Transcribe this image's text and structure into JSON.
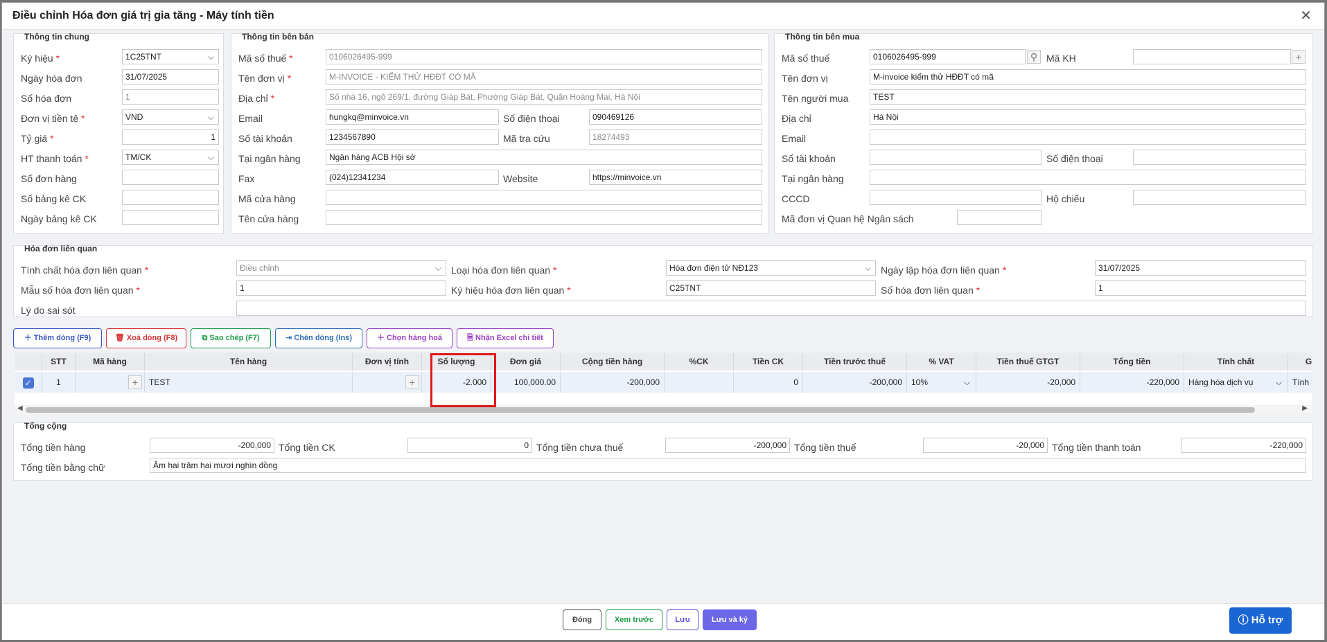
{
  "title": "Điều chỉnh Hóa đơn giá trị gia tăng - Máy tính tiền",
  "general": {
    "section": "Thông tin chung",
    "ky_hieu_label": "Ký hiệu",
    "ky_hieu": "1C25TNT",
    "ngay_hd_label": "Ngày hóa đơn",
    "ngay_hd": "31/07/2025",
    "so_hd_label": "Số hóa đơn",
    "so_hd": "1",
    "don_vi_tt_label": "Đơn vị tiền tệ",
    "don_vi_tt": "VND",
    "ty_gia_label": "Tỷ giá",
    "ty_gia": "1",
    "ht_tt_label": "HT thanh toán",
    "ht_tt": "TM/CK",
    "so_don_hang_label": "Số đơn hàng",
    "so_bang_ke_label": "Số bảng kê CK",
    "ngay_bang_ke_label": "Ngày bảng kê CK"
  },
  "seller": {
    "section": "Thông tin bên bán",
    "mst_label": "Mã số thuế",
    "mst": "0106026495-999",
    "ten_dv_label": "Tên đơn vị",
    "ten_dv": "M-INVOICE - KIỂM THỬ HĐĐT CÓ MÃ",
    "dia_chi_label": "Địa chỉ",
    "dia_chi": "Số nhà 16, ngõ 269/1, đường Giáp Bát, Phường Giáp Bát, Quận Hoàng Mai, Hà Nội",
    "email_label": "Email",
    "email": "hungkq@minvoice.vn",
    "sdt_label": "Số điện thoại",
    "sdt": "090469126",
    "stk_label": "Số tài khoản",
    "stk": "1234567890",
    "ma_tra_cuu_label": "Mã tra cứu",
    "ma_tra_cuu": "18274493",
    "ngan_hang_label": "Tại ngân hàng",
    "ngan_hang": "Ngân hàng ACB Hội sở",
    "fax_label": "Fax",
    "fax": "(024)12341234",
    "website_label": "Website",
    "website": "https://minvoice.vn",
    "ma_cua_hang_label": "Mã cửa hàng",
    "ten_cua_hang_label": "Tên cửa hàng"
  },
  "buyer": {
    "section": "Thông tin bên mua",
    "mst_label": "Mã số thuế",
    "mst": "0106026495-999",
    "ma_kh_label": "Mã KH",
    "ten_dv_label": "Tên đơn vị",
    "ten_dv": "M-invoice kiểm thử HĐĐT có mã",
    "ten_nguoi_mua_label": "Tên người mua",
    "ten_nguoi_mua": "TEST",
    "dia_chi_label": "Địa chỉ",
    "dia_chi": "Hà Nội",
    "email_label": "Email",
    "stk_label": "Số tài khoản",
    "sdt_label": "Số điện thoại",
    "ngan_hang_label": "Tại ngân hàng",
    "cccd_label": "CCCD",
    "ho_chieu_label": "Hộ chiếu",
    "ma_dv_qhns_label": "Mã đơn vị Quan hệ Ngân sách"
  },
  "related": {
    "section": "Hóa đơn liên quan",
    "tinh_chat_label": "Tính chất hóa đơn liên quan",
    "tinh_chat": "Điều chỉnh",
    "loai_hd_label": "Loại hóa đơn liên quan",
    "loai_hd": "Hóa đơn điện tử NĐ123",
    "ngay_lap_label": "Ngày lập hóa đơn liên quan",
    "ngay_lap": "31/07/2025",
    "mau_so_label": "Mẫu số hóa đơn liên quan",
    "mau_so": "1",
    "ky_hieu_label": "Ký hiệu hóa đơn liên quan",
    "ky_hieu": "C25TNT",
    "so_hd_label": "Số hóa đơn liên quan",
    "so_hd": "1",
    "ly_do_label": "Lý do sai sót"
  },
  "toolbar": {
    "add": "Thêm dòng (F9)",
    "delete": "Xoá dòng (F8)",
    "copy": "Sao chép (F7)",
    "insert": "Chèn dòng (Ins)",
    "choose": "Chọn hàng hoá",
    "excel": "Nhận Excel chi tiết"
  },
  "grid": {
    "headers": [
      "STT",
      "Mã hàng",
      "Tên hàng",
      "Đơn vị tính",
      "Số lượng",
      "Đơn giá",
      "Cộng tiền hàng",
      "%CK",
      "Tiền CK",
      "Tiền trước thuế",
      "% VAT",
      "Tiền thuế GTGT",
      "Tổng tiền",
      "Tính chất",
      "G"
    ],
    "row": {
      "stt": "1",
      "ten_hang": "TEST",
      "so_luong": "-2.000",
      "don_gia": "100,000.00",
      "cong_tien_hang": "-200,000",
      "tien_ck": "0",
      "tien_truoc_thue": "-200,000",
      "vat": "10%",
      "tien_thue": "-20,000",
      "tong_tien": "-220,000",
      "tinh_chat": "Hàng hóa dịch vụ",
      "extra": "Tính"
    }
  },
  "totals": {
    "section": "Tổng cộng",
    "tong_tien_hang_label": "Tổng tiền hàng",
    "tong_tien_hang": "-200,000",
    "tong_ck_label": "Tổng tiền CK",
    "tong_ck": "0",
    "chua_thue_label": "Tổng tiền chưa thuế",
    "chua_thue": "-200,000",
    "tien_thue_label": "Tổng tiền thuế",
    "tien_thue": "-20,000",
    "thanh_toan_label": "Tổng tiền thanh toán",
    "thanh_toan": "-220,000",
    "bang_chu_label": "Tổng tiền bằng chữ",
    "bang_chu": "Âm hai trăm hai mươi nghìn đồng"
  },
  "footer": {
    "close": "Đóng",
    "preview": "Xem trước",
    "save": "Lưu",
    "save_sign": "Lưu và ký"
  },
  "help": "Hỗ trợ",
  "colors": {
    "primary": "#6b67e6",
    "help": "#1a66d3",
    "highlight": "#e01818",
    "required": "#e03030"
  }
}
